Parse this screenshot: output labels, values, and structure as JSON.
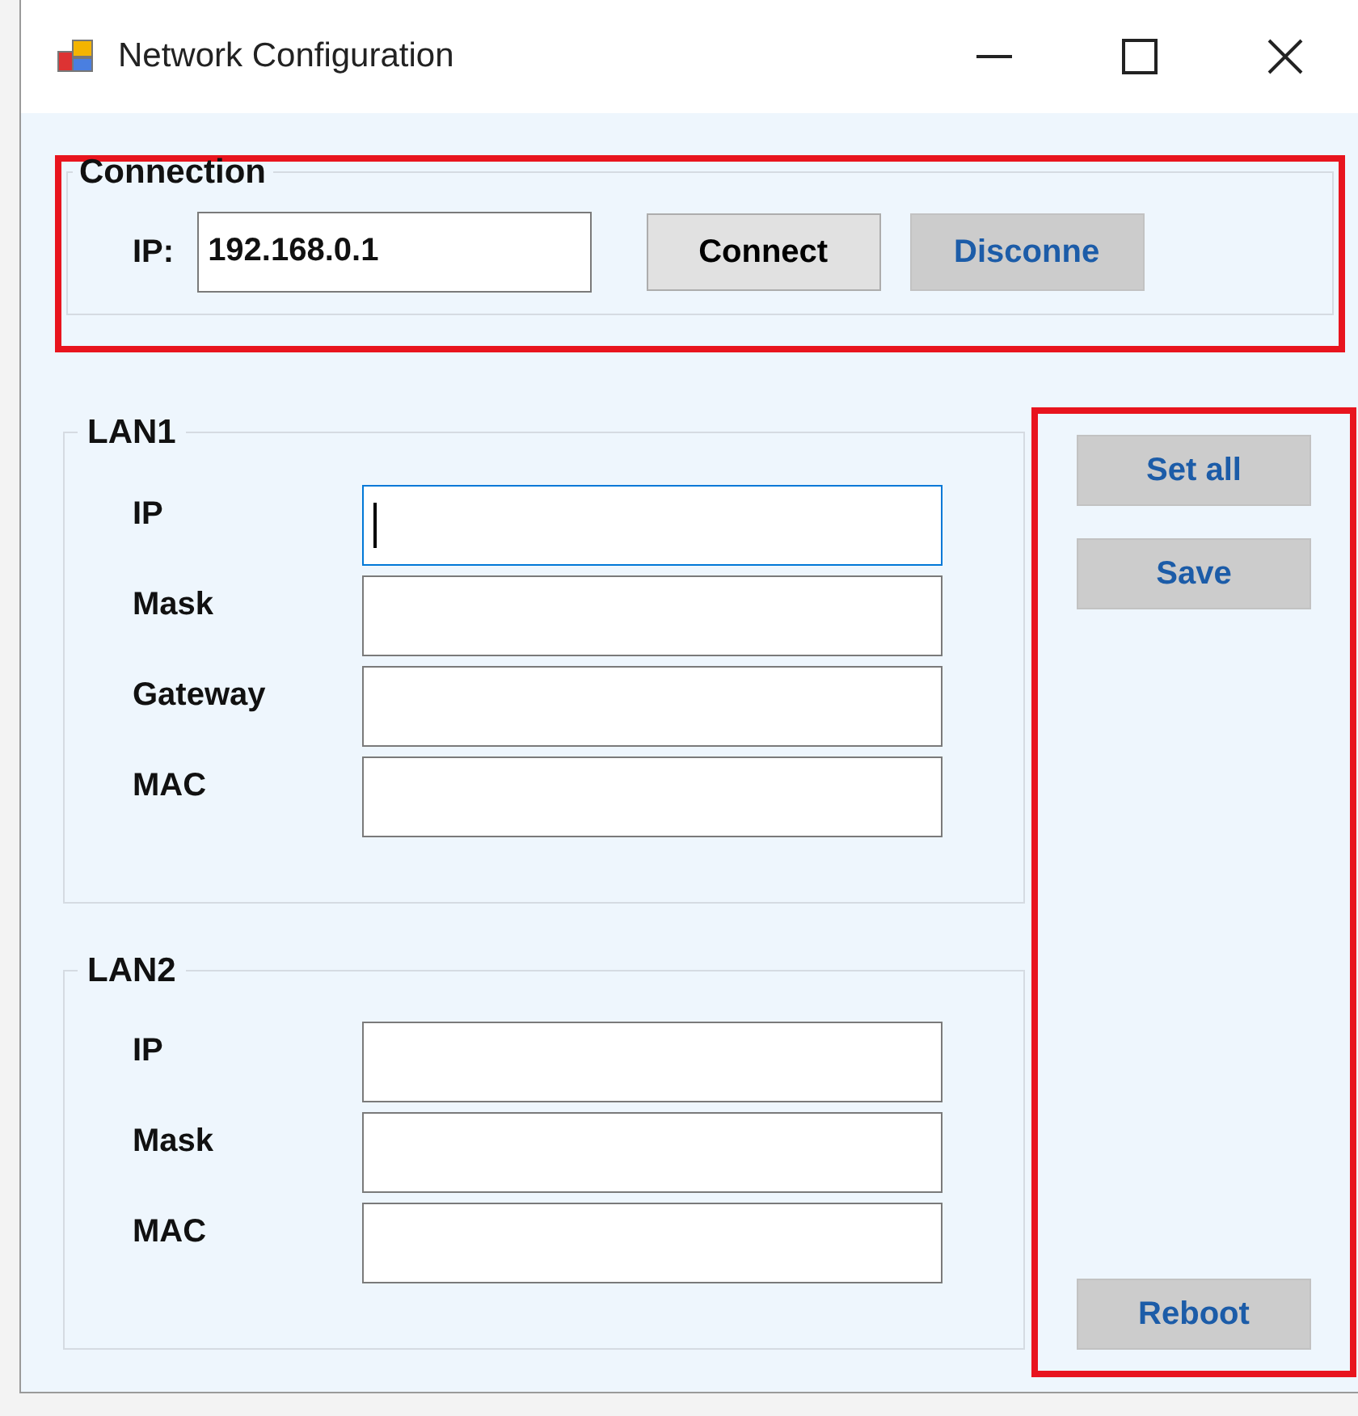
{
  "window": {
    "title": "Network Configuration"
  },
  "connection": {
    "title": "Connection",
    "highlighted": true,
    "ip_label": "IP:",
    "ip_value": "192.168.0.1",
    "buttons": [
      {
        "label": "Connect",
        "kind": "normal"
      },
      {
        "label": "Disconne",
        "kind": "accent"
      }
    ]
  },
  "groups": [
    {
      "title": "LAN1",
      "fields": [
        {
          "label": "IP",
          "focused": true
        },
        {
          "label": "Mask",
          "focused": false
        },
        {
          "label": "Gateway",
          "focused": false
        },
        {
          "label": "MAC",
          "focused": false
        }
      ]
    },
    {
      "title": "LAN2",
      "fields": [
        {
          "label": "IP",
          "focused": false
        },
        {
          "label": "Mask",
          "focused": false
        },
        {
          "label": "MAC",
          "focused": false
        }
      ]
    }
  ],
  "actions": {
    "highlighted": true,
    "buttons": [
      {
        "label": "Set all",
        "kind": "top"
      },
      {
        "label": "Save",
        "kind": "top"
      },
      {
        "label": "Reboot",
        "kind": "bottom"
      }
    ]
  }
}
